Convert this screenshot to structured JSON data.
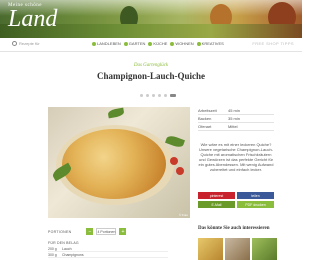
{
  "header": {
    "logo_small": "Meine schöne",
    "logo_big": "Land",
    "search_placeholder": "Rezepte für",
    "menu": [
      {
        "label": "LANDLEBEN"
      },
      {
        "label": "GARTEN"
      },
      {
        "label": "KÜCHE"
      },
      {
        "label": "WOHNEN"
      },
      {
        "label": "KREATIVES"
      }
    ],
    "right_text": "FREE SHOP TIPPS"
  },
  "recipe": {
    "kicker": "Das Gartenglück",
    "title": "Champignon-Lauch-Quiche",
    "photo_caption": "© Foto",
    "info": [
      {
        "key": "Arbeitszeit",
        "value": "45 min"
      },
      {
        "key": "Backen",
        "value": "35 min"
      },
      {
        "key": "Ofenart",
        "value": "Mittel"
      }
    ],
    "description": "Wie wäre es mit einer leckeren Quiche? Unsere vegetarische Champignon-Lauch-Quiche mit aromatischen Frischkräutern und Gewürzen ist das perfekte Gericht für ein gutes Abendessen. Mit wenig Aufwand zubereitet und einfach lecker.",
    "share": [
      "pinterest",
      "teilen",
      "E-Mail",
      "PDF drucken"
    ],
    "portions_label": "PORTIONEN",
    "portions_value": "4 Portionen",
    "ingredients_heading": "FÜR DEN BELAG",
    "ingredients": [
      {
        "amount": "200 g",
        "name": "Lauch"
      },
      {
        "amount": "300 g",
        "name": "Champignons"
      }
    ],
    "also_title": "Das könnte Sie auch interessieren"
  }
}
